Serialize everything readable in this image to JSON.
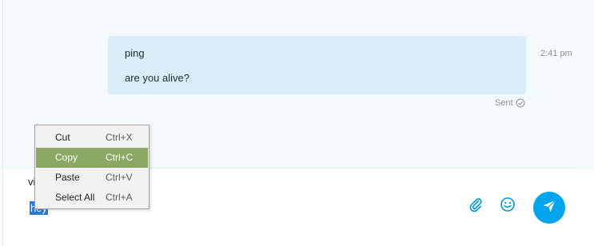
{
  "conversation": {
    "messages": [
      "ping",
      "are you alive?"
    ],
    "timestamp": "2:41 pm",
    "status": "Sent"
  },
  "compose": {
    "typed_prefix": "vi",
    "selected_text": "hey"
  },
  "context_menu": {
    "items": [
      {
        "label": "Cut",
        "shortcut": "Ctrl+X"
      },
      {
        "label": "Copy",
        "shortcut": "Ctrl+C"
      },
      {
        "label": "Paste",
        "shortcut": "Ctrl+V"
      },
      {
        "label": "Select All",
        "shortcut": "Ctrl+A"
      }
    ],
    "highlighted": "Copy"
  },
  "colors": {
    "accent": "#00a6ed",
    "bubble": "#d9eef8",
    "menu_highlight": "#8aa763",
    "selection": "#2b7ad6"
  },
  "icons": [
    "sent-check-icon",
    "paperclip-icon",
    "emoji-icon",
    "send-icon"
  ]
}
